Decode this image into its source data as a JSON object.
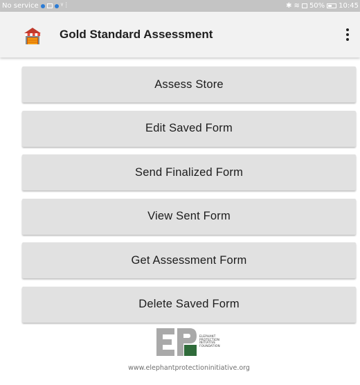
{
  "status_bar": {
    "left_text": "No service",
    "time": "10:45",
    "battery_percent": "50%",
    "icons": [
      "notification-icon",
      "gallery-icon",
      "sync-icon",
      "signal-icon",
      "bluetooth-icon",
      "wifi-icon",
      "battery-icon"
    ]
  },
  "app_bar": {
    "title": "Gold Standard Assessment",
    "icon": "store-icon",
    "menu_icon": "overflow-menu-icon"
  },
  "buttons": [
    {
      "label": "Assess Store"
    },
    {
      "label": "Edit Saved Form"
    },
    {
      "label": "Send Finalized Form"
    },
    {
      "label": "View Sent Form"
    },
    {
      "label": "Get Assessment Form"
    },
    {
      "label": "Delete Saved Form"
    }
  ],
  "footer": {
    "logo_letters": "EP",
    "logo_lines": [
      "ELEPHANT",
      "PROTECTION",
      "INITIATIVE",
      "FOUNDATION"
    ],
    "website": "www.elephantprotectioninitiative.org"
  },
  "colors": {
    "status_bar_bg": "#c4c4c4",
    "app_bar_bg": "#f2f2f2",
    "button_bg": "#e1e1e1",
    "logo_gray": "#a9a9a9",
    "logo_green": "#2f6b3a",
    "store_awning": "#c0392b"
  }
}
